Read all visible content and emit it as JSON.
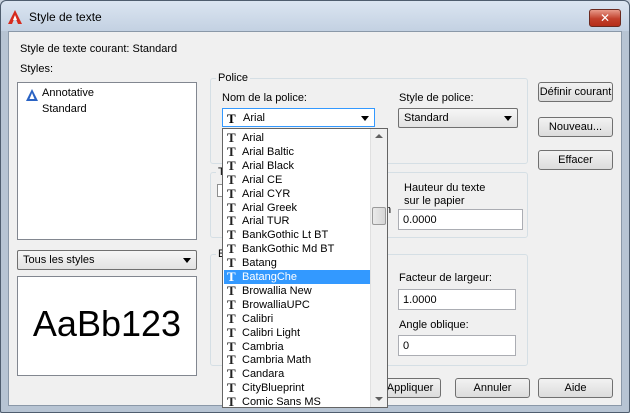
{
  "window": {
    "title": "Style de texte",
    "close_label": "✕"
  },
  "current_style": "Style de texte courant: Standard",
  "styles": {
    "label": "Styles:",
    "items": [
      "Annotative",
      "Standard"
    ],
    "filter_value": "Tous les styles",
    "preview_text": "AaBb123"
  },
  "police": {
    "group_title": "Police",
    "font_name_label": "Nom de la police:",
    "font_name_value": "Arial",
    "font_style_label": "Style de police:",
    "font_style_value": "Standard"
  },
  "size": {
    "group_title_fragment": "T",
    "height_label_line1": "Hauteur du texte",
    "height_label_line2": "sur le papier",
    "height_value": "0.0000",
    "partial_label": "n"
  },
  "effects": {
    "group_title_fragment": "E",
    "width_factor_label": "Facteur de largeur:",
    "width_factor_value": "1.0000",
    "oblique_label": "Angle oblique:",
    "oblique_value": "0"
  },
  "buttons": {
    "set_current": "Définir courant",
    "new": "Nouveau...",
    "delete": "Effacer",
    "apply": "Appliquer",
    "cancel": "Annuler",
    "help": "Aide"
  },
  "font_list": {
    "glyph": "T",
    "selected_index": 10,
    "items": [
      "Arial",
      "Arial Baltic",
      "Arial Black",
      "Arial CE",
      "Arial CYR",
      "Arial Greek",
      "Arial TUR",
      "BankGothic Lt BT",
      "BankGothic Md BT",
      "Batang",
      "BatangChe",
      "Browallia New",
      "BrowalliaUPC",
      "Calibri",
      "Calibri Light",
      "Cambria",
      "Cambria Math",
      "Candara",
      "CityBlueprint",
      "Comic Sans MS"
    ]
  },
  "colors": {
    "selection": "#3399ff",
    "close_red": "#c2402c"
  }
}
